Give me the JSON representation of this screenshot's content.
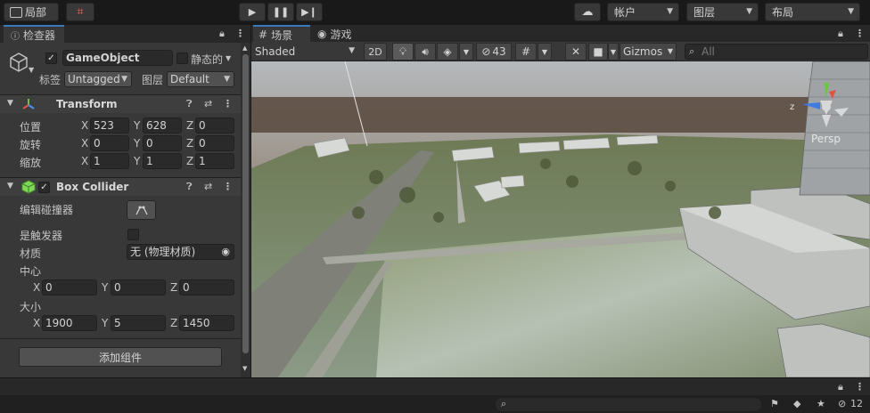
{
  "toolbar": {
    "account_label": "局部",
    "play_icon": "play-icon",
    "pause_icon": "pause-icon",
    "step_icon": "step-icon",
    "account_menu": "帐户",
    "layers_menu": "图层",
    "layout_menu": "布局"
  },
  "inspector": {
    "tab_label": "检查器",
    "object_name": "GameObject",
    "static_label": "静态的",
    "tag_label": "标签",
    "tag_value": "Untagged",
    "layer_label": "图层",
    "layer_value": "Default",
    "transform": {
      "title": "Transform",
      "position_label": "位置",
      "rotation_label": "旋转",
      "scale_label": "缩放",
      "position": {
        "x": "523",
        "y": "628",
        "z": "0"
      },
      "rotation": {
        "x": "0",
        "y": "0",
        "z": "0"
      },
      "scale": {
        "x": "1",
        "y": "1",
        "z": "1"
      }
    },
    "box_collider": {
      "title": "Box Collider",
      "edit_label": "编辑碰撞器",
      "trigger_label": "是触发器",
      "material_label": "材质",
      "material_value": "无 (物理材质)",
      "center_label": "中心",
      "size_label": "大小",
      "center": {
        "x": "0",
        "y": "0",
        "z": "0"
      },
      "size": {
        "x": "1900",
        "y": "5",
        "z": "1450"
      }
    },
    "add_component": "添加组件",
    "axis_x": "X",
    "axis_y": "Y",
    "axis_z": "Z"
  },
  "scene": {
    "tab_scene": "场景",
    "tab_game": "游戏",
    "shading_mode": "Shaded",
    "mode_2d": "2D",
    "hidden_count": "43",
    "gizmos_label": "Gizmos",
    "search_placeholder": "All",
    "projection_label": "Persp",
    "gizmo_axis_z": "z"
  },
  "console": {
    "count": "12"
  },
  "colors": {
    "accent": "#3a79bb",
    "panel": "#383838",
    "dark": "#191919"
  }
}
